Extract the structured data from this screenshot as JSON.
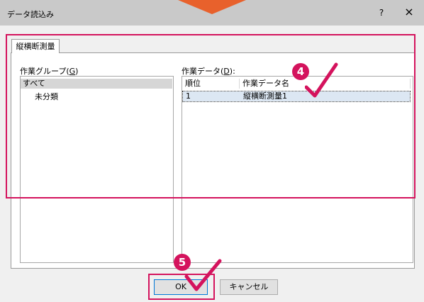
{
  "window": {
    "title": "データ読込み",
    "help_label": "?",
    "close_label": "×"
  },
  "tab": {
    "label": "縦横断測量"
  },
  "group_section": {
    "label_prefix": "作業グループ(",
    "label_accel": "G",
    "label_suffix": ")",
    "items": [
      "すべて",
      "未分類"
    ]
  },
  "data_section": {
    "label_prefix": "作業データ(",
    "label_accel": "D",
    "label_suffix": "):",
    "columns": [
      "順位",
      "作業データ名"
    ],
    "rows": [
      {
        "rank": "1",
        "name": "縦横断測量1"
      }
    ]
  },
  "buttons": {
    "ok": "OK",
    "cancel": "キャンセル"
  },
  "steps": {
    "step4": "4",
    "step5": "5"
  },
  "colors": {
    "highlight": "#d4135d",
    "arrow": "#e8612c",
    "selected_row": "#dce7f3"
  }
}
